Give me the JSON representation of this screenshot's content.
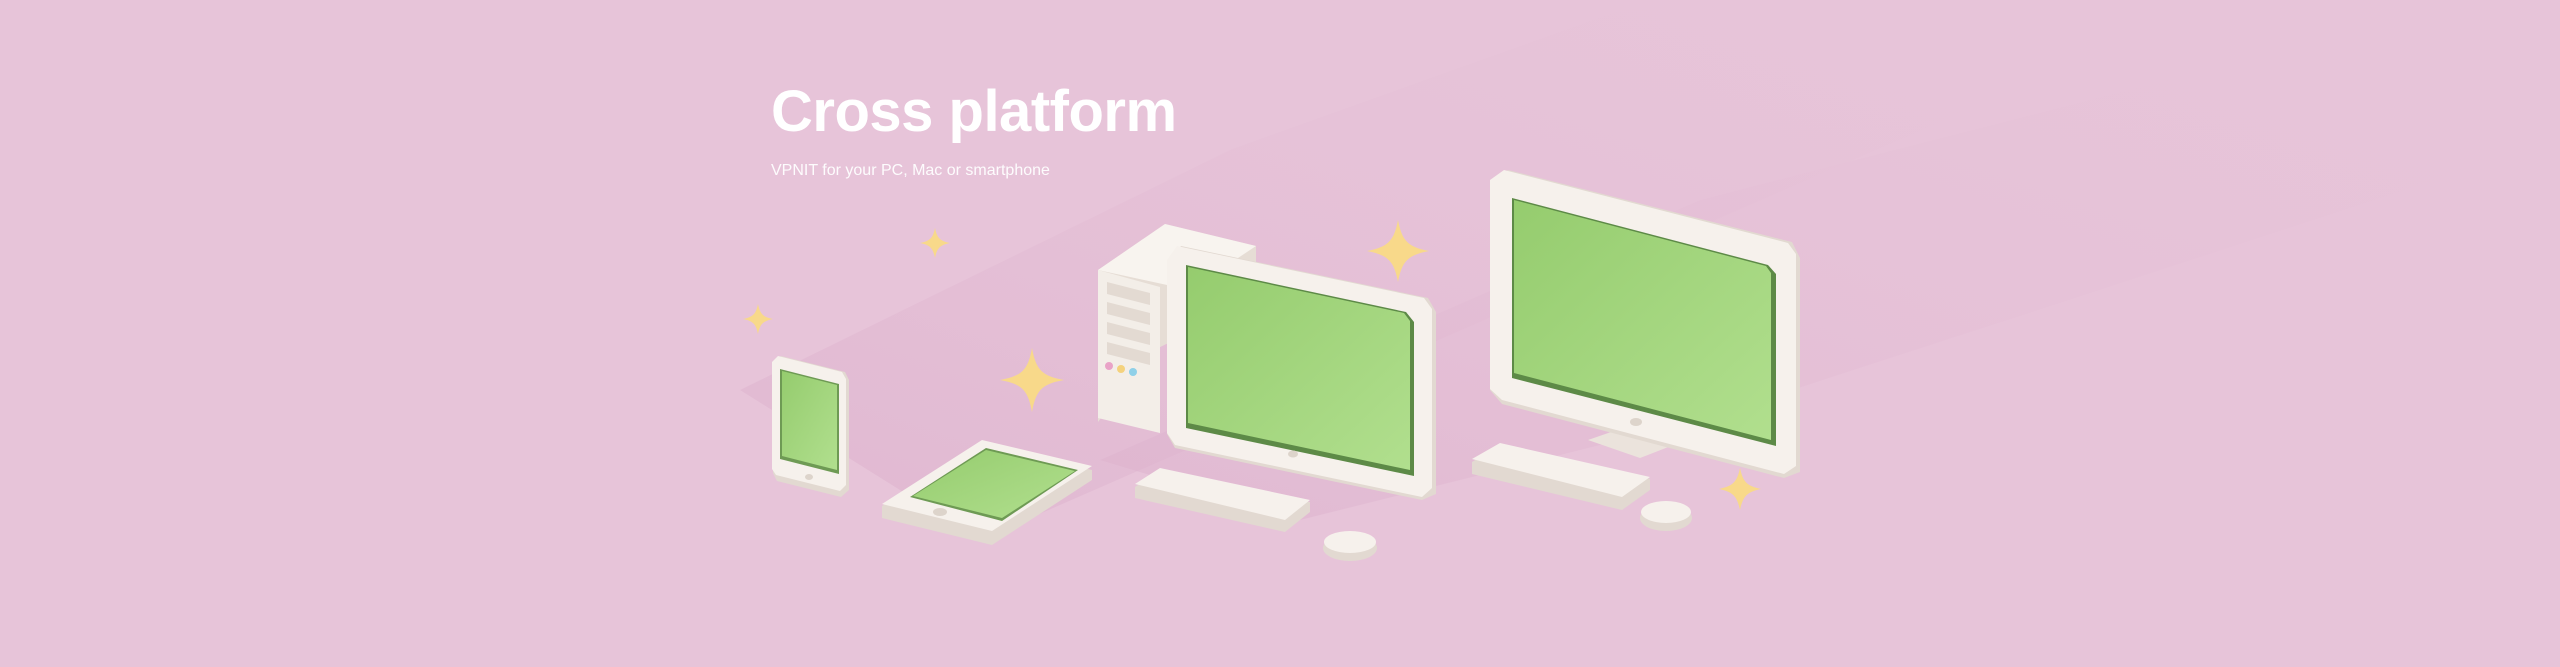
{
  "hero": {
    "title": "Cross platform",
    "subtitle": "VPNIT for your PC, Mac or smartphone"
  },
  "colors": {
    "background": "#e7c4d9",
    "shadow": "#dbb0cb",
    "device_body": "#f6f1ec",
    "device_edge": "#e2d9d1",
    "screen": "#a4d87d",
    "screen_dark": "#8dc46a",
    "sparkle": "#f8d98a"
  },
  "illustration": {
    "devices": [
      "smartphone",
      "tablet",
      "desktop-pc",
      "monitor"
    ],
    "icons": [
      "sparkle-icon"
    ]
  }
}
